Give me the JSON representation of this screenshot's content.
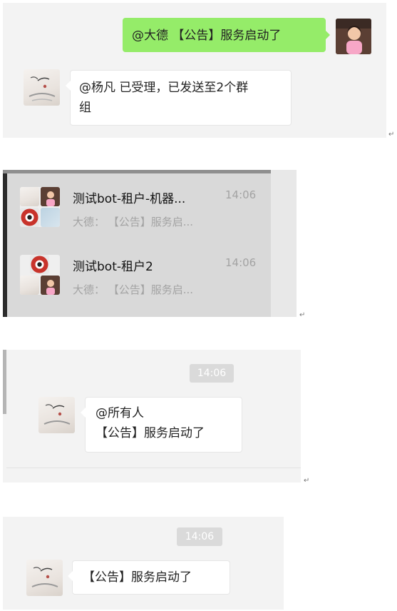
{
  "section1": {
    "outgoing_message": "@大德 【公告】服务启动了",
    "reply_line1": "@杨凡 已受理，已发送至2个群",
    "reply_line2": "组"
  },
  "chat_list": [
    {
      "name": "测试bot-租户-机器...",
      "preview": "大德： 【公告】服务启...",
      "time": "14:06"
    },
    {
      "name": "测试bot-租户2",
      "preview": "大德： 【公告】服务启...",
      "time": "14:06"
    }
  ],
  "section3": {
    "time": "14:06",
    "line1": "@所有人",
    "line2": "【公告】服务启动了"
  },
  "section4": {
    "time": "14:06",
    "message": "【公告】服务启动了"
  },
  "return_mark": "↵",
  "colors": {
    "accent_green": "#95ec69",
    "panel_bg": "#f3f3f3",
    "list_bg": "#dcdcdc"
  },
  "icons": [
    "ink-painting-avatar-icon",
    "child-photo-avatar-icon",
    "red-eye-avatar-icon"
  ]
}
